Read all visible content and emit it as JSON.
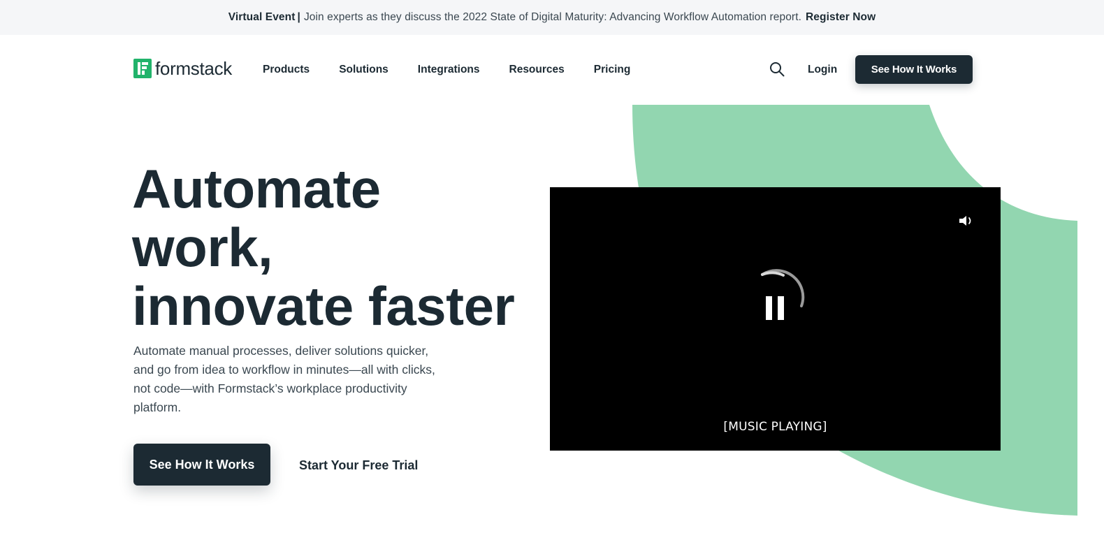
{
  "announcement": {
    "label": "Virtual Event",
    "separator": "|",
    "message": "Join experts as they discuss the 2022 State of Digital Maturity: Advancing Workflow Automation report.",
    "link": "Register Now"
  },
  "header": {
    "logo_text": "formstack",
    "nav": [
      {
        "label": "Products"
      },
      {
        "label": "Solutions"
      },
      {
        "label": "Integrations"
      },
      {
        "label": "Resources"
      },
      {
        "label": "Pricing"
      }
    ],
    "search_icon": "search-icon",
    "login_label": "Login",
    "cta_label": "See How It Works"
  },
  "hero": {
    "title_lines": [
      "Automate",
      "work,",
      "innovate faster"
    ],
    "subtitle": "Automate manual processes, deliver solutions quicker, and go from idea to workflow in minutes—all with clicks, not code—with Formstack’s workplace productivity platform.",
    "primary_cta": "See How It Works",
    "secondary_cta": "Start Your Free Trial"
  },
  "video": {
    "caption": "[MUSIC PLAYING]",
    "volume_icon": "volume-icon",
    "pause_icon": "pause-icon",
    "loading_icon": "loading-spinner-icon"
  },
  "colors": {
    "brand_dark": "#1c2a33",
    "brand_green": "#21b36b",
    "accent_green": "#92d6b0",
    "topbar_bg": "#f5f6f8"
  }
}
